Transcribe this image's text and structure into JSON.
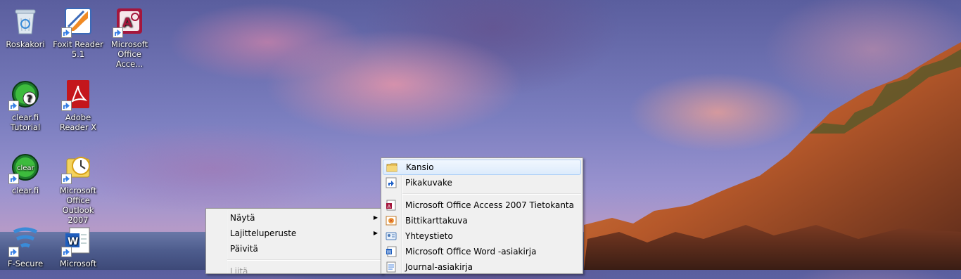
{
  "desktop": {
    "icons": [
      {
        "label": "Roskakori",
        "icon": "recycle-bin-icon"
      },
      {
        "label": "Foxit Reader 5.1",
        "icon": "foxit-reader-icon"
      },
      {
        "label": "Microsoft Office Acce...",
        "icon": "access-icon"
      },
      {
        "label": "clear.fi Tutorial",
        "icon": "clearfi-tutorial-icon"
      },
      {
        "label": "Adobe Reader X",
        "icon": "adobe-reader-icon"
      },
      {
        "label": "clear.fi",
        "icon": "clearfi-icon"
      },
      {
        "label": "Microsoft Office Outlook 2007",
        "icon": "outlook-icon"
      },
      {
        "label": "F-Secure",
        "icon": "fsecure-icon"
      },
      {
        "label": "Microsoft",
        "icon": "word-icon"
      }
    ]
  },
  "context_menu": {
    "items": [
      {
        "label": "Näytä",
        "submenu": true
      },
      {
        "label": "Lajitteluperuste",
        "submenu": true
      },
      {
        "label": "Päivitä",
        "submenu": false
      },
      {
        "label": "Liitä",
        "disabled": true
      }
    ]
  },
  "new_submenu": {
    "items": [
      {
        "label": "Kansio",
        "icon": "folder-icon"
      },
      {
        "label": "Pikakuvake",
        "icon": "shortcut-icon"
      },
      {
        "label": "Microsoft Office Access 2007 Tietokanta",
        "icon": "access-db-icon"
      },
      {
        "label": "Bittikarttakuva",
        "icon": "bitmap-icon"
      },
      {
        "label": "Yhteystieto",
        "icon": "contact-icon"
      },
      {
        "label": "Microsoft Office Word -asiakirja",
        "icon": "word-doc-icon"
      },
      {
        "label": "Journal-asiakirja",
        "icon": "journal-icon"
      }
    ]
  }
}
